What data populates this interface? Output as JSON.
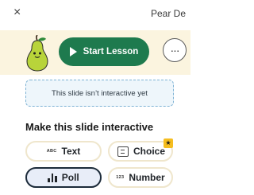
{
  "header": {
    "close_glyph": "×",
    "title": "Pear De"
  },
  "lesson_bar": {
    "start_label": "Start Lesson",
    "more_glyph": "···"
  },
  "notice": {
    "text": "This slide isn’t interactive yet"
  },
  "section": {
    "title": "Make this slide interactive"
  },
  "options": {
    "text": {
      "icon_text": "ABC",
      "label": "Text"
    },
    "choice": {
      "label": "Choice",
      "badge_glyph": "★"
    },
    "poll": {
      "label": "Poll"
    },
    "number": {
      "icon_text": "123",
      "label": "Number"
    }
  },
  "colors": {
    "brand_green": "#1e7a4e",
    "lesson_bar_bg": "#fbf4df",
    "notice_border": "#7fb3d5",
    "poll_selected_bg": "#e8edf8",
    "star_badge": "#f5bd1f"
  }
}
